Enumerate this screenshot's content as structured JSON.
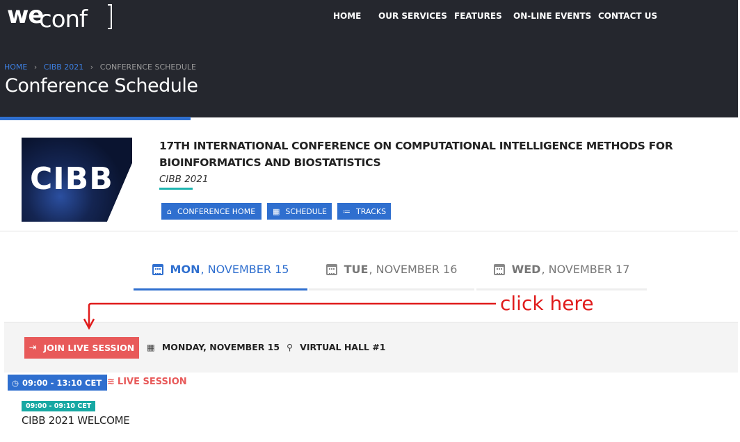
{
  "site": {
    "logo_we": "we",
    "logo_conf": "conf"
  },
  "nav": {
    "items": [
      {
        "label": "HOME"
      },
      {
        "label": "OUR SERVICES"
      },
      {
        "label": "FEATURES"
      },
      {
        "label": "ON-LINE EVENTS"
      },
      {
        "label": "CONTACT US"
      }
    ]
  },
  "breadcrumb": {
    "items": [
      "HOME",
      "CIBB 2021",
      "CONFERENCE SCHEDULE"
    ],
    "separator": "›"
  },
  "page": {
    "title": "Conference Schedule"
  },
  "conference": {
    "logo_text": "CIBB",
    "title": "17TH INTERNATIONAL CONFERENCE ON COMPUTATIONAL INTELLIGENCE METHODS FOR BIOINFORMATICS AND BIOSTATISTICS",
    "short_name": "CIBB 2021",
    "buttons": [
      {
        "label": "CONFERENCE HOME",
        "icon": "home-icon"
      },
      {
        "label": "SCHEDULE",
        "icon": "calendar-icon"
      },
      {
        "label": "TRACKS",
        "icon": "list-icon"
      }
    ]
  },
  "tabs": [
    {
      "day": "MON",
      "date": ", NOVEMBER 15",
      "active": true
    },
    {
      "day": "TUE",
      "date": ", NOVEMBER 16",
      "active": false
    },
    {
      "day": "WED",
      "date": ", NOVEMBER 17",
      "active": false
    }
  ],
  "session": {
    "join_label": "JOIN LIVE SESSION",
    "date_label": "MONDAY, NOVEMBER 15",
    "location_label": "VIRTUAL HALL #1",
    "time_range": "09:00 - 13:10 CET",
    "live_label": "LIVE SESSION",
    "slots": [
      {
        "time": "09:00 - 09:10 CET",
        "title": "CIBB 2021 WELCOME"
      }
    ]
  },
  "annotation": {
    "text": "click here"
  },
  "colors": {
    "header_bg": "#25272e",
    "accent_blue": "#2f6fcf",
    "live_red": "#e85a5a",
    "teal": "#17a8a3",
    "annotation_red": "#e01b1b"
  }
}
